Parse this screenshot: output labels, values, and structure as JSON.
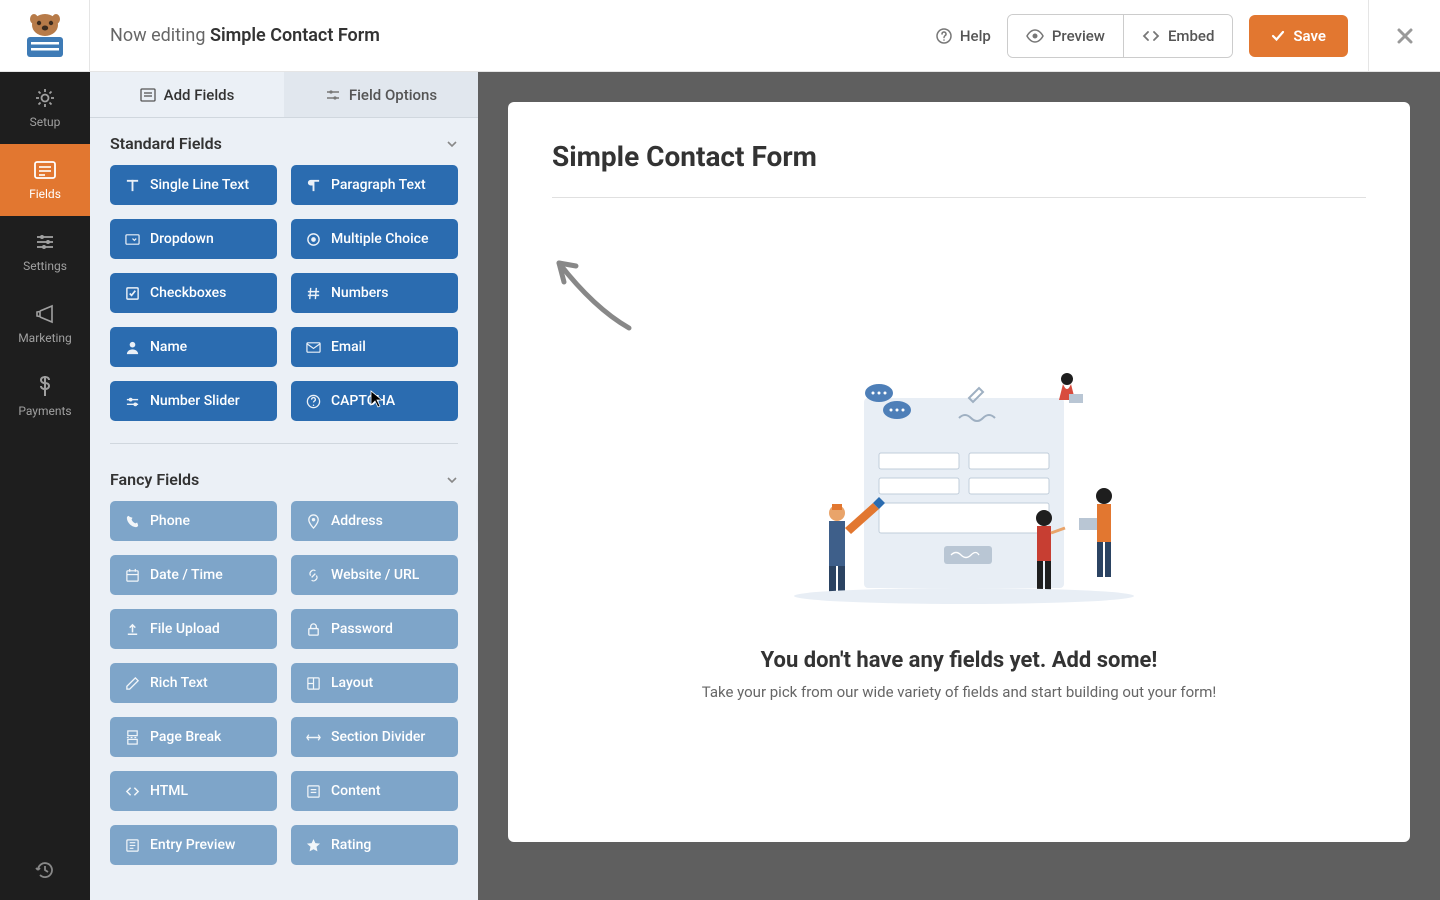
{
  "header": {
    "prefix": "Now editing ",
    "form_name": "Simple Contact Form",
    "help": "Help",
    "preview": "Preview",
    "embed": "Embed",
    "save": "Save"
  },
  "leftnav": {
    "items": [
      {
        "label": "Setup",
        "icon": "gear"
      },
      {
        "label": "Fields",
        "icon": "form",
        "active": true
      },
      {
        "label": "Settings",
        "icon": "sliders"
      },
      {
        "label": "Marketing",
        "icon": "megaphone"
      },
      {
        "label": "Payments",
        "icon": "dollar"
      }
    ]
  },
  "sidebar": {
    "tabs": {
      "add": "Add Fields",
      "options": "Field Options"
    },
    "sections": [
      {
        "title": "Standard Fields",
        "muted": false,
        "fields": [
          {
            "label": "Single Line Text",
            "icon": "text"
          },
          {
            "label": "Paragraph Text",
            "icon": "paragraph"
          },
          {
            "label": "Dropdown",
            "icon": "dropdown"
          },
          {
            "label": "Multiple Choice",
            "icon": "radio"
          },
          {
            "label": "Checkboxes",
            "icon": "checkbox"
          },
          {
            "label": "Numbers",
            "icon": "hash"
          },
          {
            "label": "Name",
            "icon": "user"
          },
          {
            "label": "Email",
            "icon": "envelope"
          },
          {
            "label": "Number Slider",
            "icon": "slider"
          },
          {
            "label": "CAPTCHA",
            "icon": "help"
          }
        ]
      },
      {
        "title": "Fancy Fields",
        "muted": true,
        "fields": [
          {
            "label": "Phone",
            "icon": "phone"
          },
          {
            "label": "Address",
            "icon": "pin"
          },
          {
            "label": "Date / Time",
            "icon": "calendar"
          },
          {
            "label": "Website / URL",
            "icon": "link"
          },
          {
            "label": "File Upload",
            "icon": "upload"
          },
          {
            "label": "Password",
            "icon": "lock"
          },
          {
            "label": "Rich Text",
            "icon": "edit"
          },
          {
            "label": "Layout",
            "icon": "layout"
          },
          {
            "label": "Page Break",
            "icon": "pagebreak"
          },
          {
            "label": "Section Divider",
            "icon": "divider"
          },
          {
            "label": "HTML",
            "icon": "code"
          },
          {
            "label": "Content",
            "icon": "content"
          },
          {
            "label": "Entry Preview",
            "icon": "preview"
          },
          {
            "label": "Rating",
            "icon": "star"
          }
        ]
      }
    ]
  },
  "canvas": {
    "form_title": "Simple Contact Form",
    "empty_title": "You don't have any fields yet. Add some!",
    "empty_sub": "Take your pick from our wide variety of fields and start building out your form!"
  }
}
